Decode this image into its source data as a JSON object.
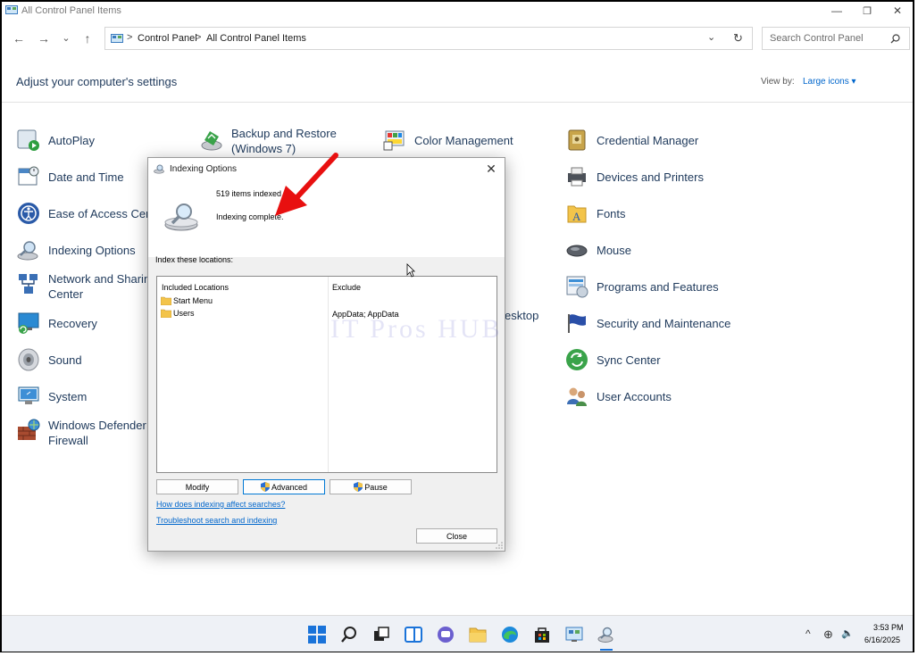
{
  "window": {
    "title": "All Control Panel Items",
    "minimize_glyph": "—",
    "maximize_glyph": "❐",
    "close_glyph": "✕"
  },
  "nav": {
    "back": "←",
    "forward": "→",
    "recent": "⌄",
    "up": "↑",
    "breadcrumb": [
      "Control Panel",
      "All Control Panel Items"
    ],
    "separator": ">",
    "dropdown": "⌄",
    "refresh": "↻"
  },
  "search": {
    "placeholder": "Search Control Panel"
  },
  "header": {
    "title": "Adjust your computer's settings",
    "view_by_label": "View by:",
    "view_by_value": "Large icons ▾"
  },
  "items": {
    "col1": [
      "AutoPlay",
      "Date and Time",
      "Ease of Access Cent",
      "Indexing Options",
      "Network and Sharin\nCenter",
      "Recovery",
      "Sound",
      "System",
      "Windows Defender\nFirewall"
    ],
    "col2": [
      "Backup and Restore\n(Windows 7)"
    ],
    "col3": [
      "Color Management",
      "esktop"
    ],
    "col4": [
      "Credential Manager",
      "Devices and Printers",
      "Fonts",
      "Mouse",
      "Programs and Features",
      "Security and Maintenance",
      "Sync Center",
      "User Accounts"
    ]
  },
  "dialog": {
    "title": "Indexing Options",
    "close_glyph": "✕",
    "items_indexed": "519 items indexed",
    "status": "Indexing complete.",
    "locations_label": "Index these locations:",
    "col_included": "Included Locations",
    "col_exclude": "Exclude",
    "locations": [
      {
        "name": "Start Menu",
        "exclude": ""
      },
      {
        "name": "Users",
        "exclude": "AppData; AppData"
      }
    ],
    "buttons": {
      "modify": "Modify",
      "advanced": "Advanced",
      "pause": "Pause",
      "close": "Close"
    },
    "links": {
      "how": "How does indexing affect searches?",
      "troubleshoot": "Troubleshoot search and indexing"
    }
  },
  "watermark": "IT Pros HUB",
  "taskbar": {
    "time": "3:53 PM",
    "date": "6/16/2025",
    "overflow_glyph": "^",
    "language_glyph": "⊕",
    "volume_glyph": "🔈"
  },
  "colors": {
    "accent": "#0078d4",
    "link": "#0066cc",
    "arrow": "#e81010",
    "heading": "#1e395b"
  }
}
